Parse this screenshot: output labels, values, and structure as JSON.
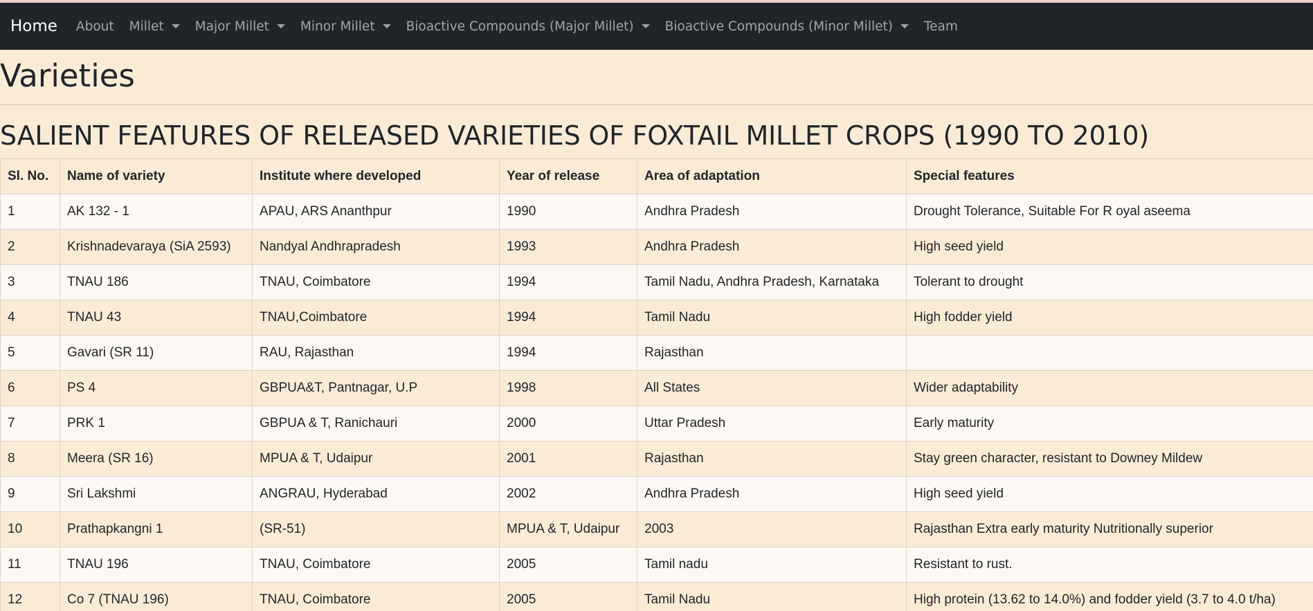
{
  "nav": {
    "brand": "Home",
    "items": [
      {
        "label": "About",
        "dropdown": false
      },
      {
        "label": "Millet",
        "dropdown": true
      },
      {
        "label": "Major Millet",
        "dropdown": true
      },
      {
        "label": "Minor Millet",
        "dropdown": true
      },
      {
        "label": "Bioactive Compounds (Major Millet)",
        "dropdown": true
      },
      {
        "label": "Bioactive Compounds (Minor Millet)",
        "dropdown": true
      },
      {
        "label": "Team",
        "dropdown": false
      }
    ]
  },
  "page": {
    "title": "Varieties",
    "section_title": "SALIENT FEATURES OF RELEASED VARIETIES OF FOXTAIL MILLET CROPS (1990 TO 2010)"
  },
  "table": {
    "headers": [
      "Sl. No.",
      "Name of variety",
      "Institute where developed",
      "Year of release",
      "Area of adaptation",
      "Special features"
    ],
    "rows": [
      [
        "1",
        "AK 132 - 1",
        "APAU, ARS Ananthpur",
        "1990",
        "Andhra Pradesh",
        "Drought Tolerance, Suitable For R oyal aseema"
      ],
      [
        "2",
        "Krishnadevaraya (SiA 2593)",
        "Nandyal Andhrapradesh",
        "1993",
        "Andhra Pradesh",
        "High seed yield"
      ],
      [
        "3",
        "TNAU 186",
        "TNAU, Coimbatore",
        "1994",
        "Tamil Nadu, Andhra Pradesh, Karnataka",
        "Tolerant to drought"
      ],
      [
        "4",
        "TNAU 43",
        "TNAU,Coimbatore",
        "1994",
        "Tamil Nadu",
        "High fodder yield"
      ],
      [
        "5",
        "Gavari (SR 11)",
        "RAU, Rajasthan",
        "1994",
        "Rajasthan",
        ""
      ],
      [
        "6",
        "PS 4",
        "GBPUA&T, Pantnagar, U.P",
        "1998",
        "All States",
        "Wider adaptability"
      ],
      [
        "7",
        "PRK 1",
        "GBPUA & T, Ranichauri",
        "2000",
        "Uttar Pradesh",
        "Early maturity"
      ],
      [
        "8",
        "Meera (SR 16)",
        "MPUA & T, Udaipur",
        "2001",
        "Rajasthan",
        "Stay green character, resistant to Downey Mildew"
      ],
      [
        "9",
        "Sri Lakshmi",
        "ANGRAU, Hyderabad",
        "2002",
        "Andhra Pradesh",
        "High seed yield"
      ],
      [
        "10",
        "Prathapkangni 1",
        "(SR-51)",
        "MPUA & T, Udaipur",
        "2003",
        "Rajasthan Extra early maturity Nutritionally superior"
      ],
      [
        "11",
        "TNAU 196",
        "TNAU, Coimbatore",
        "2005",
        "Tamil nadu",
        "Resistant to rust."
      ],
      [
        "12",
        "Co 7 (TNAU 196)",
        "TNAU, Coimbatore",
        "2005",
        "Tamil Nadu",
        "High protein (13.62 to 14.0%) and fodder yield (3.7 to 4.0 t/ha)"
      ]
    ]
  }
}
